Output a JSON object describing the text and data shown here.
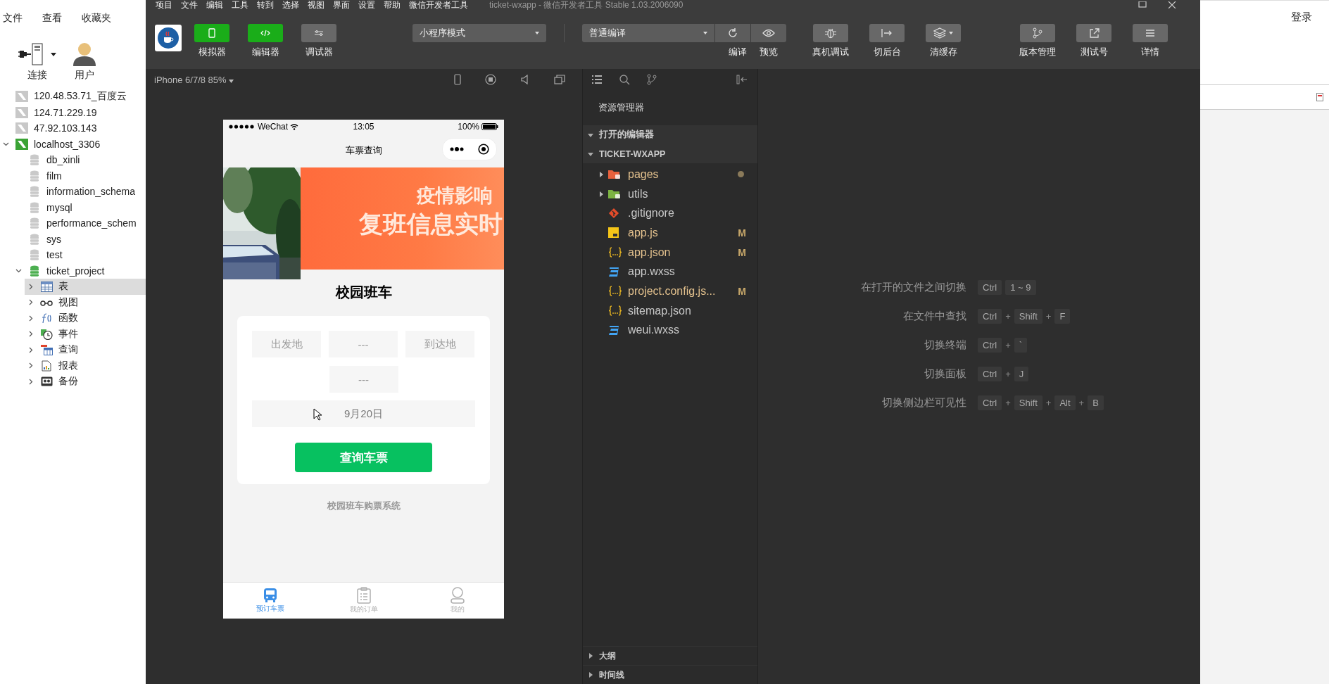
{
  "navicat": {
    "menu": [
      "文件",
      "查看",
      "收藏夹"
    ],
    "toolbar": [
      {
        "label": "连接",
        "kind": "connect"
      },
      {
        "label": "用户",
        "kind": "user"
      }
    ],
    "tree": [
      {
        "label": "120.48.53.71_百度云",
        "kind": "connection",
        "connected": false,
        "selected": false
      },
      {
        "label": "124.71.229.19",
        "kind": "connection",
        "connected": false,
        "selected": false
      },
      {
        "label": "47.92.103.143",
        "kind": "connection",
        "connected": false,
        "selected": false
      },
      {
        "label": "localhost_3306",
        "kind": "connection",
        "connected": true,
        "expanded": true,
        "selected": false,
        "children": [
          {
            "label": "db_xinli",
            "kind": "database",
            "connected": false,
            "selected": false
          },
          {
            "label": "film",
            "kind": "database",
            "connected": false,
            "selected": false
          },
          {
            "label": "information_schema",
            "kind": "database",
            "connected": false,
            "selected": false
          },
          {
            "label": "mysql",
            "kind": "database",
            "connected": false,
            "selected": false
          },
          {
            "label": "performance_schem",
            "kind": "database",
            "connected": false,
            "selected": false
          },
          {
            "label": "sys",
            "kind": "database",
            "connected": false,
            "selected": false
          },
          {
            "label": "test",
            "kind": "database",
            "connected": false,
            "selected": false
          },
          {
            "label": "ticket_project",
            "kind": "database",
            "connected": true,
            "expanded": true,
            "selected": false,
            "children": [
              {
                "label": "表",
                "kind": "tables",
                "expanded": false,
                "selected": true
              },
              {
                "label": "视图",
                "kind": "views",
                "expanded": false,
                "selected": false
              },
              {
                "label": "函数",
                "kind": "functions",
                "expanded": false,
                "selected": false
              },
              {
                "label": "事件",
                "kind": "events",
                "expanded": false,
                "selected": false
              },
              {
                "label": "查询",
                "kind": "queries",
                "expanded": false,
                "selected": false
              },
              {
                "label": "报表",
                "kind": "reports",
                "expanded": false,
                "selected": false
              },
              {
                "label": "备份",
                "kind": "backups",
                "expanded": false,
                "selected": false
              }
            ]
          }
        ]
      }
    ],
    "login": "登录"
  },
  "devtools": {
    "menu": [
      "项目",
      "文件",
      "编辑",
      "工具",
      "转到",
      "选择",
      "视图",
      "界面",
      "设置",
      "帮助",
      "微信开发者工具"
    ],
    "title": "ticket-wxapp - 微信开发者工具 Stable 1.03.2006090",
    "views": [
      {
        "label": "模拟器",
        "kind": "phone",
        "on": true
      },
      {
        "label": "编辑器",
        "kind": "code",
        "on": true
      },
      {
        "label": "调试器",
        "kind": "debug",
        "on": false
      }
    ],
    "mode": "小程序模式",
    "compile": "普通编译",
    "actions": [
      {
        "label": "编译",
        "kind": "refresh"
      },
      {
        "label": "预览",
        "kind": "eye"
      }
    ],
    "tools": [
      {
        "label": "真机调试",
        "kind": "bug"
      },
      {
        "label": "切后台",
        "kind": "background"
      },
      {
        "label": "清缓存",
        "kind": "layers"
      }
    ],
    "right": [
      {
        "label": "版本管理",
        "kind": "branch"
      },
      {
        "label": "测试号",
        "kind": "external"
      },
      {
        "label": "详情",
        "kind": "menu"
      }
    ]
  },
  "simulator": {
    "device": "iPhone 6/7/8 85%",
    "phone": {
      "carrier": "WeChat",
      "time": "13:05",
      "battery": "100%",
      "nav_title": "车票查询",
      "banner": [
        "疫情影响",
        "复班信息实时"
      ],
      "heading": "校园班车",
      "pickers": [
        {
          "text": "出发地"
        },
        {
          "text": "---"
        },
        {
          "text": "到达地"
        },
        {
          "text": "---"
        }
      ],
      "date": "9月20日",
      "button": "查询车票",
      "footer": "校园班车购票系统",
      "tabs": [
        {
          "label": "预订车票",
          "kind": "bus",
          "selected": true
        },
        {
          "label": "我的订单",
          "kind": "orders",
          "selected": false
        },
        {
          "label": "我的",
          "kind": "profile",
          "selected": false
        }
      ]
    }
  },
  "explorer": {
    "title": "资源管理器",
    "sections": [
      {
        "label": "打开的编辑器",
        "expanded": true
      },
      {
        "label": "TICKET-WXAPP",
        "expanded": true
      }
    ],
    "files": [
      {
        "name": "pages",
        "kind": "folder",
        "color": "#e8603c",
        "expanded": false,
        "modified": true,
        "dot": true
      },
      {
        "name": "utils",
        "kind": "folder",
        "color": "#7cb342",
        "expanded": false,
        "modified": false,
        "dot": false
      },
      {
        "name": ".gitignore",
        "kind": "git",
        "modified": false,
        "dot": false
      },
      {
        "name": "app.js",
        "kind": "js",
        "modified": true,
        "dot": false,
        "badge": "M"
      },
      {
        "name": "app.json",
        "kind": "json",
        "modified": true,
        "dot": false,
        "badge": "M"
      },
      {
        "name": "app.wxss",
        "kind": "css",
        "modified": false,
        "dot": false
      },
      {
        "name": "project.config.js...",
        "kind": "json",
        "modified": true,
        "dot": false,
        "badge": "M"
      },
      {
        "name": "sitemap.json",
        "kind": "json",
        "modified": false,
        "dot": false
      },
      {
        "name": "weui.wxss",
        "kind": "css",
        "modified": false,
        "dot": false
      }
    ],
    "panels": [
      {
        "label": "大纲",
        "expanded": false
      },
      {
        "label": "时间线",
        "expanded": false
      }
    ]
  },
  "editor": {
    "shortcuts": [
      {
        "label": "在打开的文件之间切换",
        "keys": [
          {
            "kind": "key",
            "text": "Ctrl"
          },
          {
            "kind": "key",
            "text": "1 ~ 9"
          }
        ]
      },
      {
        "label": "在文件中查找",
        "keys": [
          {
            "kind": "key",
            "text": "Ctrl"
          },
          {
            "kind": "plus",
            "text": "+"
          },
          {
            "kind": "key",
            "text": "Shift"
          },
          {
            "kind": "plus",
            "text": "+"
          },
          {
            "kind": "key",
            "text": "F"
          }
        ]
      },
      {
        "label": "切换终端",
        "keys": [
          {
            "kind": "key",
            "text": "Ctrl"
          },
          {
            "kind": "plus",
            "text": "+"
          },
          {
            "kind": "key",
            "text": "`"
          }
        ]
      },
      {
        "label": "切换面板",
        "keys": [
          {
            "kind": "key",
            "text": "Ctrl"
          },
          {
            "kind": "plus",
            "text": "+"
          },
          {
            "kind": "key",
            "text": "J"
          }
        ]
      },
      {
        "label": "切换侧边栏可见性",
        "keys": [
          {
            "kind": "key",
            "text": "Ctrl"
          },
          {
            "kind": "plus",
            "text": "+"
          },
          {
            "kind": "key",
            "text": "Shift"
          },
          {
            "kind": "plus",
            "text": "+"
          },
          {
            "kind": "key",
            "text": "Alt"
          },
          {
            "kind": "plus",
            "text": "+"
          },
          {
            "kind": "key",
            "text": "B"
          }
        ]
      }
    ]
  }
}
